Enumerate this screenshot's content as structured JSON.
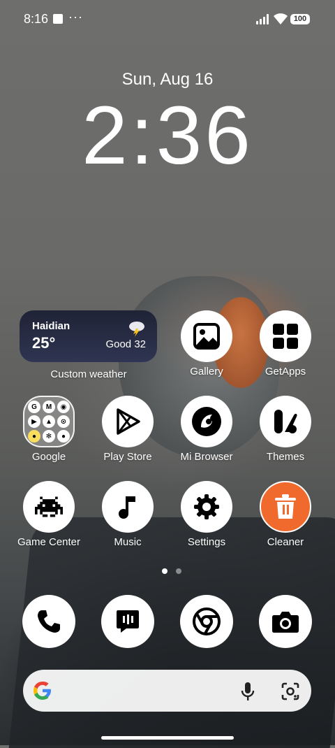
{
  "status_bar": {
    "time": "8:16",
    "overflow": "···",
    "battery": "100"
  },
  "lockscreen": {
    "date": "Sun, Aug 16",
    "clock": "2:36"
  },
  "weather_widget": {
    "city": "Haidian",
    "temperature": "25°",
    "air_quality": "Good 32",
    "label": "Custom weather",
    "icon": "thunderstorm-icon"
  },
  "apps": {
    "gallery": "Gallery",
    "getapps": "GetApps",
    "google": "Google",
    "play_store": "Play Store",
    "mi_browser": "Mi Browser",
    "themes": "Themes",
    "game_center": "Game Center",
    "music": "Music",
    "settings": "Settings",
    "cleaner": "Cleaner"
  },
  "google_folder_icons": [
    "G",
    "M",
    "◉",
    "▶",
    "▲",
    "⊙",
    "●",
    "✻",
    "●"
  ],
  "page_indicator": {
    "count": 2,
    "active": 0
  },
  "dock": [
    "phone-icon",
    "messages-icon",
    "chrome-icon",
    "camera-icon"
  ],
  "search_bar": {
    "left_icon": "google-g-icon",
    "mic_icon": "microphone-icon",
    "lens_icon": "lens-icon"
  },
  "colors": {
    "cleaner": "#ef6a2c",
    "google_blue": "#4285F4",
    "google_red": "#EA4335",
    "google_yellow": "#FBBC05",
    "google_green": "#34A853"
  }
}
